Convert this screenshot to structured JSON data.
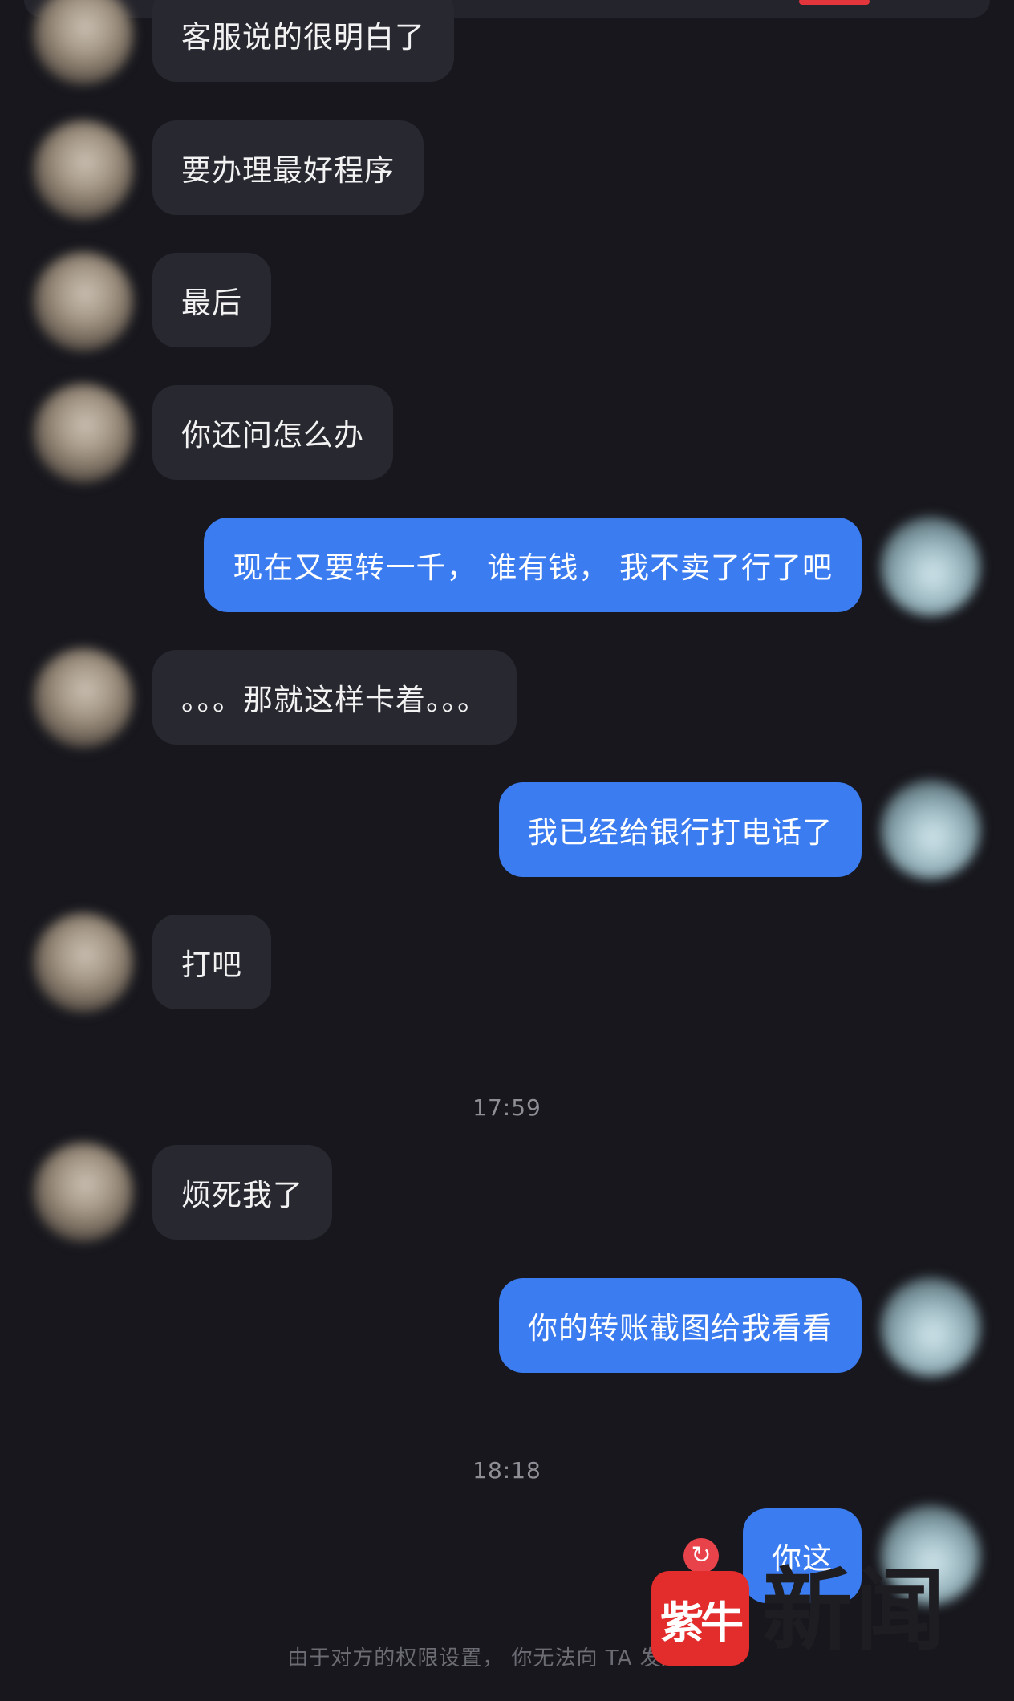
{
  "messages": [
    {
      "side": "them",
      "text": "客服说的很明白了"
    },
    {
      "side": "them",
      "text": "要办理最好程序"
    },
    {
      "side": "them",
      "text": "最后"
    },
    {
      "side": "them",
      "text": "你还问怎么办"
    },
    {
      "side": "me",
      "text": "现在又要转一千，  谁有钱，  我不卖了行了吧"
    },
    {
      "side": "them",
      "text": "。。。那就这样卡着。。。"
    },
    {
      "side": "me",
      "text": "我已经给银行打电话了"
    },
    {
      "side": "them",
      "text": "打吧"
    },
    {
      "timestamp": "17:59"
    },
    {
      "side": "them",
      "text": "烦死我了"
    },
    {
      "side": "me",
      "text": "你的转账截图给我看看"
    },
    {
      "timestamp": "18:18"
    },
    {
      "side": "me",
      "text": "你这",
      "status": "failed"
    }
  ],
  "footer_notice": "由于对方的权限设置，  你无法向 TA 发送消息",
  "watermark": {
    "logo": "紫牛",
    "text": "新闻"
  },
  "icons": {
    "retry": "retry-icon",
    "avatar_them": "contact-avatar",
    "avatar_me": "my-avatar"
  },
  "colors": {
    "background": "#17171d",
    "incoming_bubble": "#282830",
    "outgoing_bubble": "#3b7cf0",
    "failed_badge": "#e8434a",
    "watermark_red": "#e32c2c"
  }
}
